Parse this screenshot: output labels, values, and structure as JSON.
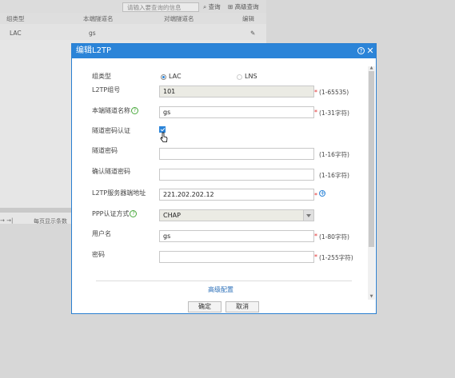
{
  "background": {
    "search_placeholder": "请输入要查询的信息",
    "search_btn": "查询",
    "advanced_search_btn": "高级查询",
    "columns": [
      "组类型",
      "本端隧道名",
      "对端隧道名",
      "编辑"
    ],
    "row": {
      "type": "LAC",
      "local": "gs"
    },
    "pager_label": "每页显示条数"
  },
  "dialog": {
    "title": "编辑L2TP",
    "fields": {
      "group_type_label": "组类型",
      "lac": "LAC",
      "lns": "LNS",
      "group_no_label": "L2TP组号",
      "group_no_value": "101",
      "group_no_hint": "(1-65535)",
      "local_name_label": "本端隧道名称",
      "local_name_value": "gs",
      "local_name_hint": "(1-31字符)",
      "tunnel_auth_label": "隧道密码认证",
      "tunnel_pwd_label": "隧道密码",
      "tunnel_pwd_hint": "(1-16字符)",
      "confirm_pwd_label": "确认隧道密码",
      "confirm_pwd_hint": "(1-16字符)",
      "server_addr_label": "L2TP服务器端地址",
      "server_addr_value": "221.202.202.12",
      "ppp_auth_label": "PPP认证方式",
      "ppp_auth_value": "CHAP",
      "username_label": "用户名",
      "username_value": "gs",
      "username_hint": "(1-80字符)",
      "password_label": "密码",
      "password_hint": "(1-255字符)",
      "required_mark": "*"
    },
    "advanced_link": "高级配置",
    "ok": "确定",
    "cancel": "取消"
  }
}
